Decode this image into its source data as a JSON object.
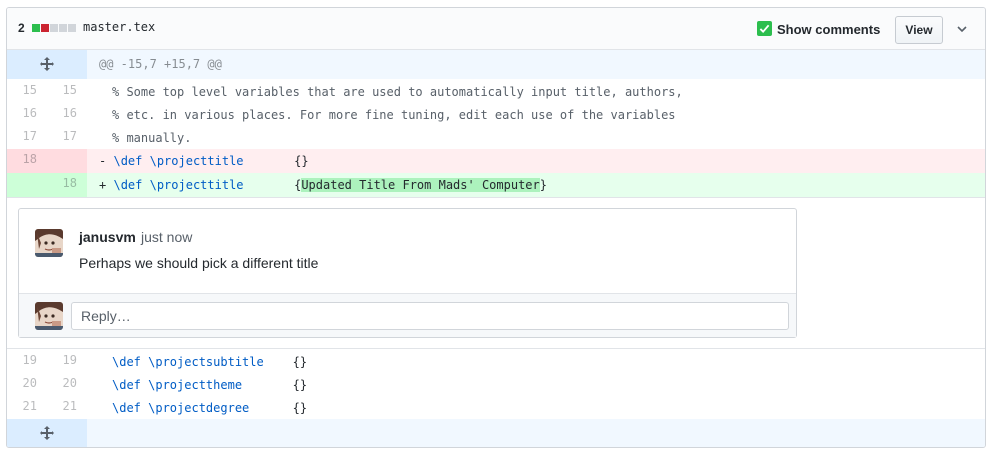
{
  "file": {
    "diffstat_count": "2",
    "blocks": [
      "#2cbe4e",
      "#cb2431",
      "#d1d5da",
      "#d1d5da",
      "#d1d5da"
    ],
    "name": "master.tex",
    "show_comments_label": "Show comments",
    "show_comments_checked": true,
    "view_label": "View"
  },
  "hunk_header": "@@ -15,7 +15,7 @@",
  "context_top": [
    {
      "old": "15",
      "new": "15",
      "text": "% Some top level variables that are used to automatically input title, authors,"
    },
    {
      "old": "16",
      "new": "16",
      "text": "% etc. in various places. For more fine tuning, edit each use of the variables"
    },
    {
      "old": "17",
      "new": "17",
      "text": "% manually."
    }
  ],
  "deletion": {
    "old": "18",
    "sign": "-",
    "cmd": "\\def \\projecttitle",
    "arg": "{}"
  },
  "addition": {
    "new": "18",
    "sign": "+",
    "cmd": "\\def \\projecttitle",
    "arg_open": "{",
    "arg_highlight": "Updated Title From Mads' Computer",
    "arg_close": "}"
  },
  "comment": {
    "author": "janusvm",
    "time": "just now",
    "body": "Perhaps we should pick a different title",
    "reply_placeholder": "Reply…"
  },
  "context_bottom": [
    {
      "old": "19",
      "new": "19",
      "cmd": "\\def \\projectsubtitle",
      "arg": "{}"
    },
    {
      "old": "20",
      "new": "20",
      "cmd": "\\def \\projecttheme",
      "arg": "{}"
    },
    {
      "old": "21",
      "new": "21",
      "cmd": "\\def \\projectdegree",
      "arg": "{}"
    }
  ],
  "colors": {
    "accent": "#0366d6",
    "deletion_bg": "#ffeef0",
    "addition_bg": "#e6ffed",
    "addition_highlight": "#acf2bd",
    "hunk_bg": "#f1f8ff"
  },
  "icons": [
    "unfold-icon",
    "check-icon",
    "chevron-down-icon",
    "avatar"
  ]
}
